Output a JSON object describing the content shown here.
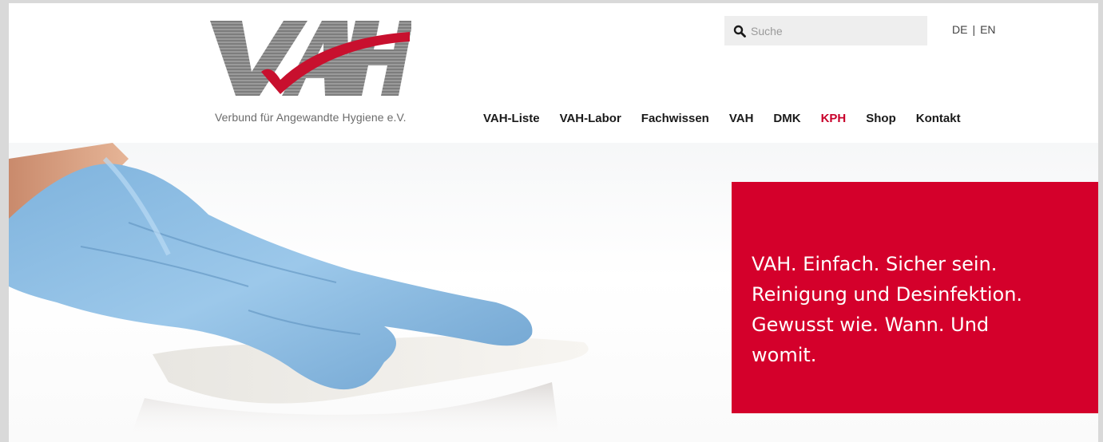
{
  "brand": {
    "logo_text": "VAH",
    "tagline": "Verbund für Angewandte Hygiene e.V.",
    "accent_color": "#d4002b",
    "logo_gray": "#8a8a8a"
  },
  "search": {
    "placeholder": "Suche",
    "icon": "search-icon"
  },
  "language": {
    "de": "DE",
    "separator": "|",
    "en": "EN"
  },
  "nav": {
    "items": [
      {
        "label": "VAH-Liste",
        "active": false
      },
      {
        "label": "VAH-Labor",
        "active": false
      },
      {
        "label": "Fachwissen",
        "active": false
      },
      {
        "label": "VAH",
        "active": false
      },
      {
        "label": "DMK",
        "active": false
      },
      {
        "label": "KPH",
        "active": true
      },
      {
        "label": "Shop",
        "active": false
      },
      {
        "label": "Kontakt",
        "active": false
      }
    ]
  },
  "hero": {
    "lines": [
      "VAH. Einfach. Sicher sein.",
      "Reinigung und Desinfektion.",
      "Gewusst wie. Wann. Und",
      "womit."
    ]
  }
}
